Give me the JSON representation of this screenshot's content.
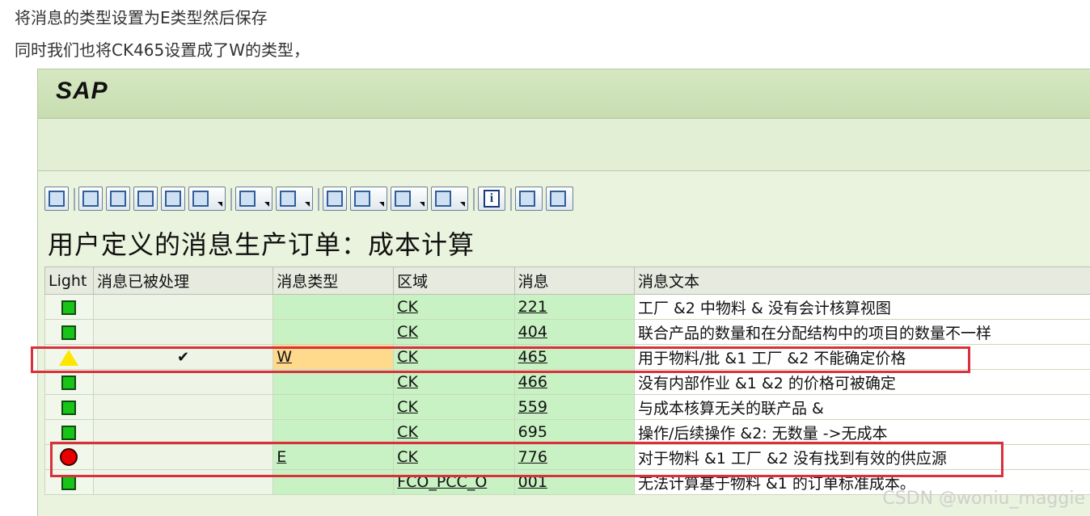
{
  "article": {
    "line1": "将消息的类型设置为E类型然后保存",
    "line2": "同时我们也将CK465设置成了W的类型，"
  },
  "sap": {
    "logo": "SAP",
    "report_title": "用户定义的消息生产订单：成本计算",
    "toolbar_icons": [
      "find-icon",
      "sort-ascending-icon",
      "sort-descending-icon",
      "search-binoculars-icon",
      "details-icon",
      "filter-icon",
      "sum-icon",
      "subtotal-icon",
      "print-icon",
      "export-icon",
      "local-file-icon",
      "layout-icon",
      "info-icon",
      "window-icon",
      "window-split-icon"
    ],
    "columns": [
      "Light",
      "消息已被处理",
      "消息类型",
      "区域",
      "消息",
      "消息文本"
    ],
    "rows": [
      {
        "light": "green",
        "processed": "",
        "type": "",
        "area": "CK",
        "msg": "221",
        "text": "工厂 &2 中物料 & 没有会计核算视图"
      },
      {
        "light": "green",
        "processed": "",
        "type": "",
        "area": "CK",
        "msg": "404",
        "text": "联合产品的数量和在分配结构中的项目的数量不一样"
      },
      {
        "light": "yellow",
        "processed": "✔",
        "type": "W",
        "area": "CK",
        "msg": "465",
        "text": "用于物料/批 &1 工厂 &2 不能确定价格"
      },
      {
        "light": "green",
        "processed": "",
        "type": "",
        "area": "CK",
        "msg": "466",
        "text": "没有内部作业 &1 &2 的价格可被确定"
      },
      {
        "light": "green",
        "processed": "",
        "type": "",
        "area": "CK",
        "msg": "559",
        "text": "与成本核算无关的联产品 &"
      },
      {
        "light": "green",
        "processed": "",
        "type": "",
        "area": "CK",
        "msg": "695",
        "text": "操作/后续操作 &2: 无数量 ->无成本"
      },
      {
        "light": "red",
        "processed": "",
        "type": "E",
        "area": "CK",
        "msg": "776",
        "text": "对于物料 &1 工厂 &2 没有找到有效的供应源"
      },
      {
        "light": "green",
        "processed": "",
        "type": "",
        "area": "FCO_PCC_O",
        "msg": "001",
        "text": "无法计算基于物料 &1 的订单标准成本。"
      }
    ]
  },
  "watermark": "CSDN @woniu_maggie",
  "colors": {
    "highlight": "#d9303b",
    "green_cell": "#c9f2c4",
    "warn_cell": "#ffd98c",
    "sap_bg": "#eaf3dd"
  }
}
